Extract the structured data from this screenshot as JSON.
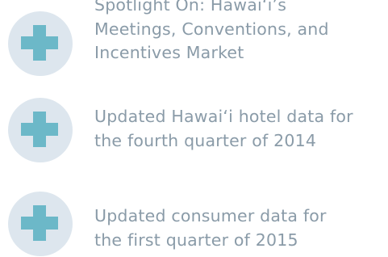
{
  "items": [
    {
      "icon": "plus-icon",
      "lines": [
        "Spotlight On: Hawai‘i’s",
        "Meetings, Conventions, and",
        "Incentives Market"
      ]
    },
    {
      "icon": "plus-icon",
      "lines": [
        "Updated Hawai‘i hotel data for",
        "the fourth quarter of 2014"
      ]
    },
    {
      "icon": "plus-icon",
      "lines": [
        "Updated consumer data for",
        "the first quarter of 2015"
      ]
    }
  ],
  "colors": {
    "circle_background": "#dde6ee",
    "plus": "#6cb8c8",
    "text": "#8a9ba8"
  }
}
